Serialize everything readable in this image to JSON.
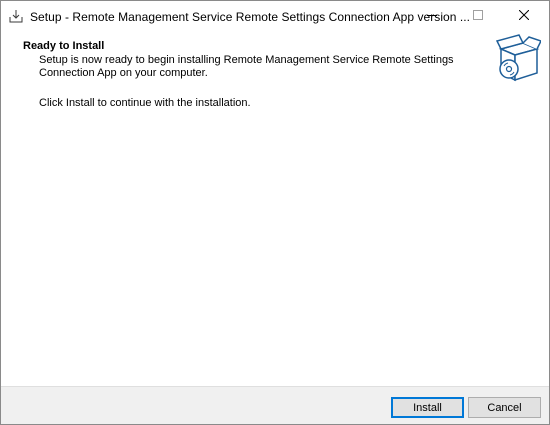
{
  "window": {
    "title": "Setup - Remote Management Service Remote Settings Connection App version ...",
    "app_icon": "installer-tray-icon",
    "controls": {
      "minimize_icon": "minimize-icon",
      "maximize_icon": "maximize-icon",
      "close_icon": "close-icon"
    }
  },
  "header": {
    "title": "Ready to Install",
    "description": "Setup is now ready to begin installing Remote Management Service Remote Settings Connection App on your computer.",
    "image_icon": "setup-box-cd-icon"
  },
  "content": {
    "instruction": "Click Install to continue with the installation."
  },
  "footer": {
    "install_label": "Install",
    "cancel_label": "Cancel"
  },
  "colors": {
    "accent": "#0078d7",
    "footer_bg": "#f0f0f0",
    "button_bg": "#e1e1e1",
    "button_border": "#adadad"
  }
}
